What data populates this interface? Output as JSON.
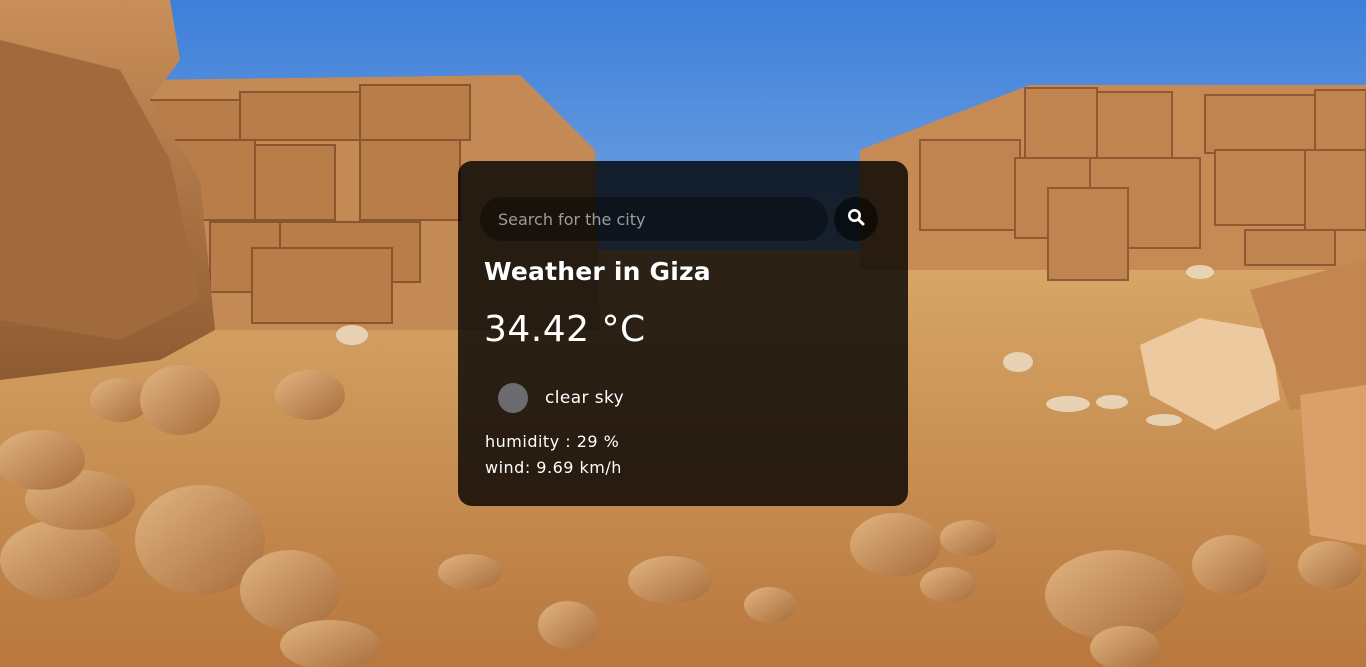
{
  "search": {
    "placeholder": "Search for the city",
    "value": "",
    "button_icon": "search-icon"
  },
  "weather": {
    "title": "Weather in Giza",
    "temperature": "34.42 °C",
    "condition_icon": "weather-condition-icon",
    "description": "clear sky",
    "humidity": "humidity : 29 %",
    "wind": "wind: 9.69 km/h"
  },
  "colors": {
    "card_background": "#000000cc",
    "text": "#ffffff",
    "placeholder": "#9c9c9c",
    "sky": "#4a86d8",
    "sand": "#d9a05e"
  }
}
